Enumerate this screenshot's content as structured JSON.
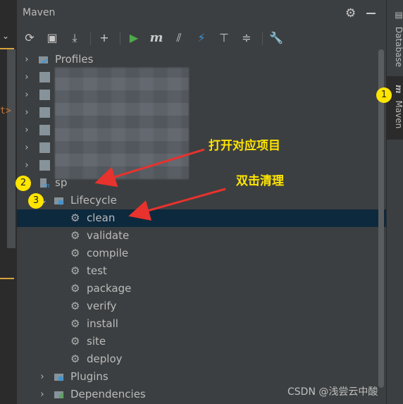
{
  "panel": {
    "title": "Maven",
    "toolbar": [
      {
        "name": "reload-icon",
        "glyph": "⟳"
      },
      {
        "name": "add-folder-icon",
        "glyph": "▣"
      },
      {
        "name": "download-icon",
        "glyph": "⤓"
      },
      {
        "name": "add-icon",
        "glyph": "+"
      },
      {
        "name": "run-icon",
        "glyph": "▶"
      },
      {
        "name": "maven-goal-icon",
        "glyph": "m"
      },
      {
        "name": "toggle-offline-icon",
        "glyph": "⫽"
      },
      {
        "name": "skip-tests-icon",
        "glyph": "⚡"
      },
      {
        "name": "show-dependencies-icon",
        "glyph": "⊤"
      },
      {
        "name": "collapse-all-icon",
        "glyph": "≑"
      },
      {
        "name": "settings-wrench-icon",
        "glyph": "🔧"
      }
    ]
  },
  "tree": {
    "profiles": "Profiles",
    "project_partial": "sp",
    "lifecycle": "Lifecycle",
    "goals": [
      "clean",
      "validate",
      "compile",
      "test",
      "package",
      "verify",
      "install",
      "site",
      "deploy"
    ],
    "plugins": "Plugins",
    "dependencies": "Dependencies"
  },
  "side_tabs": {
    "database": "Database",
    "maven": "Maven",
    "maven_icon": "m"
  },
  "annotations": {
    "badge1": "1",
    "badge2": "2",
    "badge3": "3",
    "open_project": "打开对应项目",
    "double_click_clean": "双击清理",
    "color": "#ffe500",
    "arrow_color": "#e8322d"
  },
  "editor": {
    "gt": "t>"
  },
  "watermark": "CSDN @浅尝云中酸"
}
